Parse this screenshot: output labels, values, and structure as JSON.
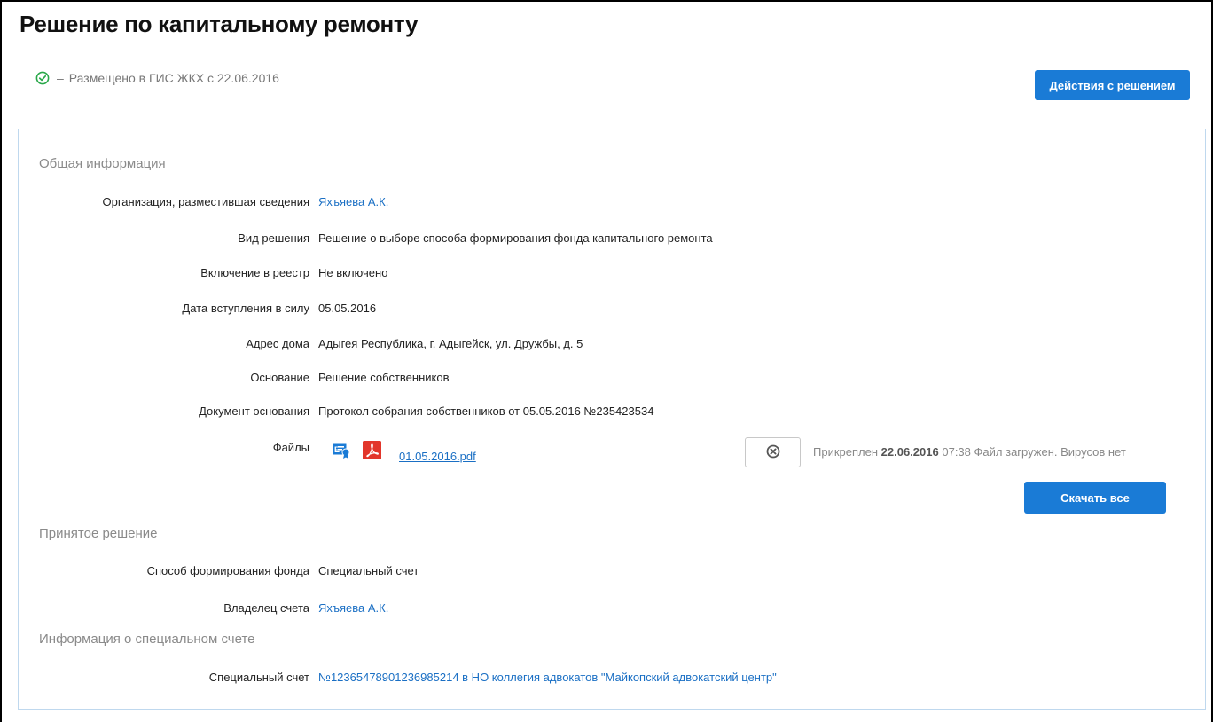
{
  "page": {
    "title": "Решение по капитальному ремонту",
    "status_dash": "–",
    "status_text": "Размещено в ГИС ЖКХ с 22.06.2016",
    "actions_button": "Действия с решением"
  },
  "colors": {
    "accent": "#1a7bd6",
    "link": "#1a6fc4",
    "status_ok": "#2aa84a",
    "pdf": "#e2362b",
    "panel_border": "#bfd8ee"
  },
  "general": {
    "title": "Общая информация",
    "rows": [
      {
        "label": "Организация, разместившая сведения",
        "value": "Яхъяева А.К."
      },
      {
        "label": "Вид решения",
        "value": "Решение о выборе способа формирования фонда капитального ремонта"
      },
      {
        "label": "Включение в реестр",
        "value": "Не включено"
      },
      {
        "label": "Дата вступления в силу",
        "value": "05.05.2016"
      },
      {
        "label": "Адрес дома",
        "value": "Адыгея Республика, г. Адыгейск, ул. Дружбы, д. 5"
      },
      {
        "label": "Основание",
        "value": "Решение собственников"
      },
      {
        "label": "Документ основания",
        "value": "Протокол собрания собственников от 05.05.2016 №235423534"
      }
    ],
    "files": {
      "label": "Файлы",
      "file_name": "01.05.2016.pdf",
      "attached_prefix": "Прикреплен",
      "attached_date": "22.06.2016",
      "attached_time": "07:38",
      "scan_status": "Файл загружен. Вирусов нет",
      "download_all": "Скачать все"
    }
  },
  "decision": {
    "title": "Принятое решение",
    "rows": [
      {
        "label": "Способ формирования фонда",
        "value": "Специальный счет"
      },
      {
        "label": "Владелец счета",
        "value": "Яхъяева А.К."
      }
    ]
  },
  "special_account": {
    "title": "Информация о специальном счете",
    "rows": [
      {
        "label": "Специальный счет",
        "value": "№12365478901236985214 в НО коллегия адвокатов \"Майкопский адвокатский центр\""
      }
    ]
  },
  "icons": [
    "check-circle-icon",
    "signature-icon",
    "pdf-icon",
    "remove-file-icon"
  ]
}
